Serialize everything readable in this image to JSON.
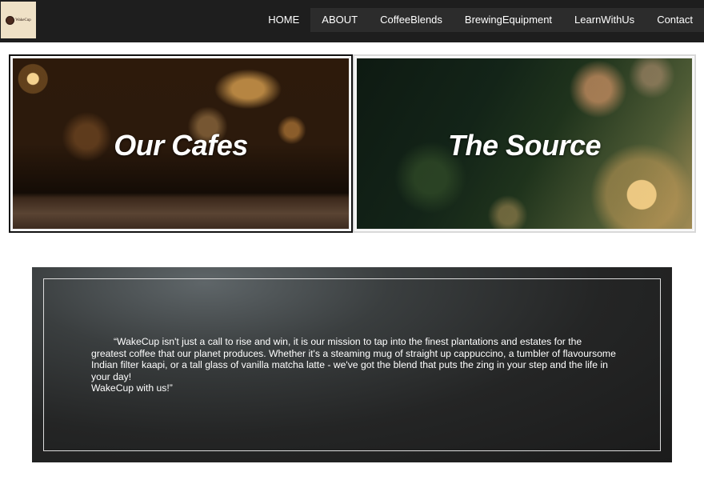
{
  "logo": {
    "text": "WakeCup"
  },
  "nav": {
    "items": [
      {
        "label": "HOME"
      },
      {
        "label": "ABOUT"
      },
      {
        "label": "CoffeeBlends"
      },
      {
        "label": "BrewingEquipment"
      },
      {
        "label": "LearnWithUs"
      },
      {
        "label": "Contact"
      }
    ]
  },
  "tiles": {
    "cafes": {
      "label": "Our Cafes"
    },
    "source": {
      "label": "The Source"
    }
  },
  "quote": {
    "text": "“WakeCup isn't just a call to rise and win, it is our mission to tap into the finest plantations and estates for the greatest coffee that our planet produces. Whether it's a steaming mug of straight up cappuccino, a tumbler of flavoursome Indian filter kaapi, or a tall glass of vanilla matcha latte - we've got the blend that puts the zing in your step and the life in your day!",
    "sign_off": "WakeCup with us!”"
  },
  "colors": {
    "navbar": "#1e1e1e",
    "text": "#ffffff",
    "logo_background": "#efe1c6"
  }
}
